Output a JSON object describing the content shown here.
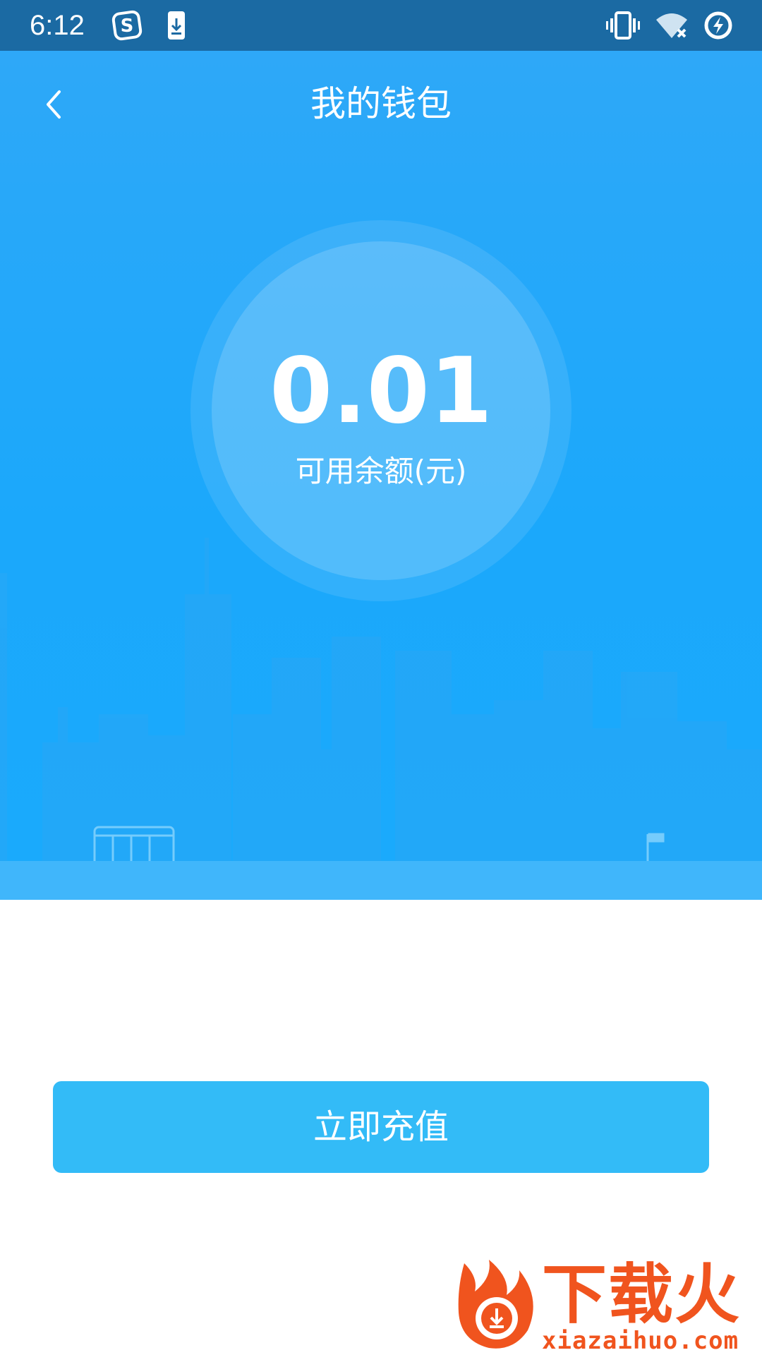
{
  "status_bar": {
    "time": "6:12",
    "background": "#1b6aa3",
    "left_icons": [
      "sogou-s-icon",
      "download-icon"
    ],
    "right_icons": [
      "vibrate-icon",
      "wifi-off-icon",
      "battery-charging-icon"
    ]
  },
  "header": {
    "title": "我的钱包",
    "back_icon": "chevron-left-icon"
  },
  "wallet": {
    "balance": "0.01",
    "balance_label": "可用余额(元)"
  },
  "actions": {
    "recharge_label": "立即充值"
  },
  "watermark": {
    "brand": "下载火",
    "url": "xiazaihuo.com",
    "color": "#f0541e"
  },
  "colors": {
    "hero_blue": "#1ba8fb",
    "button_blue": "#33bbf7"
  }
}
